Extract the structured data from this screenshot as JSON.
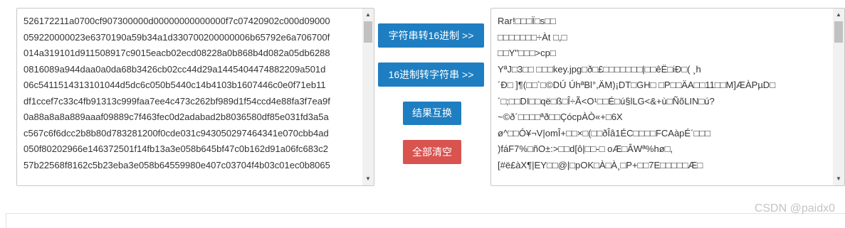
{
  "input_lines": [
    "526172211a0700cf907300000d00000000000000f7c07420902c000d09000",
    "059220000023e6370190a59b34a1d330700200000006b65792e6a706700f",
    "014a319101d911508917c9015eacb02ecd08228a0b868b4d082a05db6288",
    "0816089a944daa0a0da68b3426cb02cc44d29a1445404474882209a501d",
    "06c5411514313101044d5dc6c050b5440c14b4103b1607446c0e0f71eb11",
    "df1ccef7c33c4fb91313c999faa7ee4c473c262bf989d1f54ccd4e88fa3f7ea9f",
    "0a88a8a8a889aaaf09889c7f463fec0d2adabad2b8036580df85e031fd3a5a",
    "c567c6f6dcc2b8b80d783281200f0cde031c943050297464341e070cbb4ad",
    "050f80202966e146372501f14fb13a3e058b645bf47c0b162d91a06fc683c2",
    "57b22568f8162c5b23eba3e058b64559980e407c03704f4b03c01ec0b8065"
  ],
  "output_lines": [
    "Rar!□□□Ï□s□□",
    "□□□□□□□÷Àt □,□",
    "        □□Y\"□□□>cp□",
    "YªJ□3□□ □□□key.jpg□ð□£□□□□□□□|□□êË□iÐ□( ¸h",
    "´Ð□ ]¶(□□`□©DÚ  ÚhªBl°,ÄM)¡DT□GH□ □P□□ÄA□□11□□M]ÆÀPµD□",
    "´□;□□DI□□që□ß□Î÷Ã<O¹□□É□ú§lLG<&+ù□ÑõLIN□ú?",
    "~©ð´□□□□ªð□□ÇócpÀÒ«+□6X",
    "ø^□□Ó¥¬V|omÎ+□□×□(□□ðÎâ1ÉC□□□□FCAàpÉ´□□□",
    ")fáF7%□ñO±:>□□d[ô|□□-□ oÆ□ÂWª%hø□,",
    "[#ë£àX¶|EY□□@|□pOK□À□À¸□P+□□7E□□□□□Æ□"
  ],
  "buttons": {
    "str_to_hex": "字符串转16进制 >>",
    "hex_to_str": "16进制转字符串 >>",
    "swap": "结果互换",
    "clear_all": "全部清空"
  },
  "watermark": "CSDN @paidx0",
  "icons": {
    "scroll_up": "triangle-up-icon",
    "scroll_down": "triangle-down-icon"
  },
  "colors": {
    "primary": "#1e7ec1",
    "danger": "#d9534f"
  }
}
